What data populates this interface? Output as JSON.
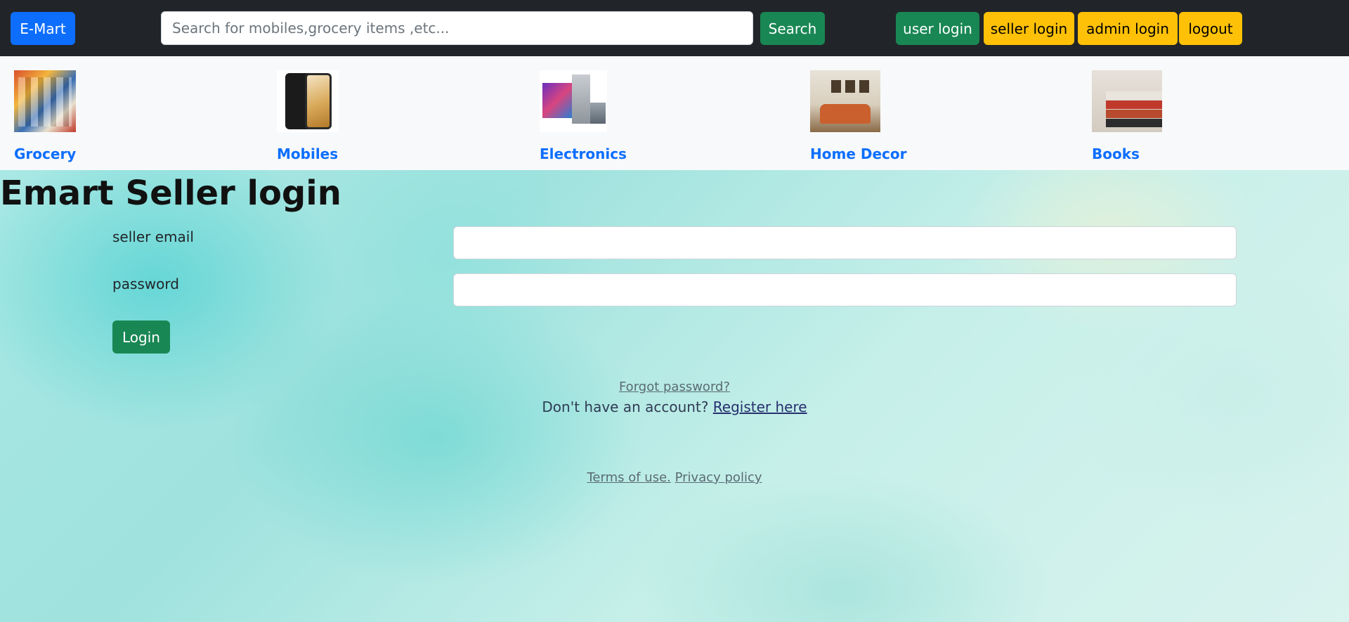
{
  "navbar": {
    "brand": "E-Mart",
    "search_placeholder": "Search for mobiles,grocery items ,etc...",
    "search_value": "",
    "search_label": "Search",
    "user_login": "user login",
    "seller_login": "seller login",
    "admin_login": "admin login",
    "logout": "logout"
  },
  "categories": [
    {
      "label": "Grocery",
      "icon": "grocery-image"
    },
    {
      "label": "Mobiles",
      "icon": "mobiles-image"
    },
    {
      "label": "Electronics",
      "icon": "electronics-image"
    },
    {
      "label": "Home Decor",
      "icon": "home-decor-image"
    },
    {
      "label": "Books",
      "icon": "books-image"
    }
  ],
  "login": {
    "title": "Emart Seller login",
    "email_label": "seller email",
    "email_value": "",
    "password_label": "password",
    "password_value": "",
    "submit": "Login",
    "forgot": "Forgot password?",
    "no_account": "Don't have an account? ",
    "register": "Register here"
  },
  "footer": {
    "terms": "Terms of use.",
    "privacy": "Privacy policy"
  },
  "colors": {
    "navbar_bg": "#212529",
    "brand_blue": "#0d6efd",
    "success_green": "#198754",
    "warning_yellow": "#ffc107",
    "category_bg": "#f8f9fa"
  }
}
